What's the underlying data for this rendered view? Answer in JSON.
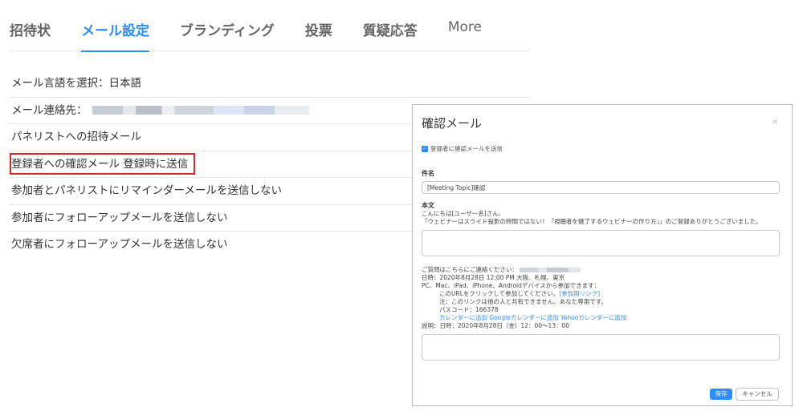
{
  "tabs": [
    {
      "label": "招待状"
    },
    {
      "label": "メール設定"
    },
    {
      "label": "ブランディング"
    },
    {
      "label": "投票"
    },
    {
      "label": "質疑応答"
    },
    {
      "label": "More"
    }
  ],
  "settings": {
    "language": "メール言語を選択：日本語",
    "contact_label": "メール連絡先：",
    "panelist_invite": "パネリストへの招待メール",
    "registrant_confirm": "登録者への確認メール 登録時に送信",
    "reminder": "参加者とパネリストにリマインダーメールを送信しない",
    "followup_attendee": "参加者にフォローアップメールを送信しない",
    "followup_absentee": "欠席者にフォローアップメールを送信しない"
  },
  "modal": {
    "title": "確認メール",
    "close": "×",
    "checkbox_label": "登録者に確認メールを送信",
    "subject_label": "件名",
    "subject_value": "[Meeting Topic]確認",
    "body_label": "本文",
    "greeting": "こんにちは[ユーザー名]さん、",
    "intro": "「ウェビナーはスライド投影の時間ではない！『視聴者を魅了するウェビナーの作り方』」のご登録ありがとうございました。",
    "contact_line": "ご質問はこちらにご連絡ください：",
    "datetime_line": "日時：2020年8月28日 12:00 PM 大阪、札幌、東京",
    "devices_line": "PC、Mac、iPad、iPhone、Androidデバイスから参加できます：",
    "url_line_prefix": "このURLをクリックして参加してください。",
    "join_link": "[参加用リンク]",
    "note_line": "注：このリンクは他の人と共有できません。あなた専用です。",
    "passcode_line": "パスコード：166378",
    "calendar_links": "カレンダーに追加  Googleカレンダーに追加  Yahooカレンダーに追加",
    "description_line": "説明：日時：2020年8月28日（金）12：00～13：00",
    "save_label": "保存",
    "cancel_label": "キャンセル"
  },
  "colors": {
    "accent": "#2d8cff",
    "highlight": "#d9262c"
  }
}
